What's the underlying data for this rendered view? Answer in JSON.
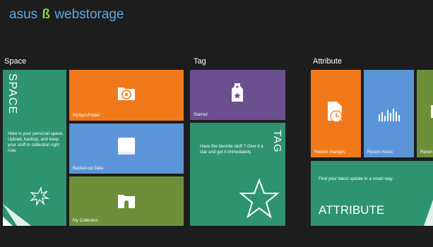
{
  "logo": {
    "part1": "asus",
    "part2": "ß",
    "part3": "webstorage"
  },
  "sections": {
    "space": {
      "title": "Space"
    },
    "tag": {
      "title": "Tag"
    },
    "attribute": {
      "title": "Attribute"
    }
  },
  "space_tile": {
    "title": "SPACE",
    "description": "Here is your personal space. Upload, backup, and keep your stuff in collection right now."
  },
  "tiles": {
    "mysync": "MySyncFolder",
    "backedup": "Backed-up Data",
    "mycollection": "My Collection",
    "starred": "Starred",
    "recent_changes": "Recent changes",
    "recent_music": "Recent music",
    "recent_partial": "Recen"
  },
  "tag_tile": {
    "title": "TAG",
    "description": "Have the favorite stuff ? Give it a star and get it immediately."
  },
  "attribute_tile": {
    "title": "ATTRIBUTE",
    "description": "Find your latest update in a smart way."
  },
  "colors": {
    "green": "#2e9470",
    "orange": "#f07a1a",
    "blue": "#5b95d8",
    "olive": "#6e8f3a",
    "purple": "#6c4f8f"
  }
}
